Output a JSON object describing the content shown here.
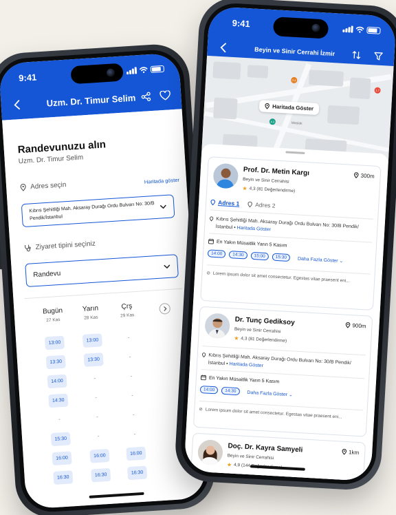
{
  "status": {
    "time": "9:41"
  },
  "colors": {
    "brand": "#1556d6",
    "chip_bg": "#e1ebfb",
    "rating_star": "#f0a020"
  },
  "left_screen": {
    "header_title": "Uzm. Dr. Timur Selim",
    "page_title": "Randevunuzu alın",
    "doctor_name": "Uzm. Dr. Timur Selim",
    "address_label": "Adres seçin",
    "map_link": "Haritada göster",
    "address_value": "Kıbrıs Şehitliği Mah. Aksaray Durağı Ordu Bulvarı No: 30/B Pendik/İstanbul",
    "visit_label": "Ziyaret tipini seçiniz",
    "visit_value": "Randevu",
    "days": [
      {
        "name": "Bugün",
        "date": "27 Kas"
      },
      {
        "name": "Yarın",
        "date": "28 Kas"
      },
      {
        "name": "Çrş",
        "date": "29 Kas"
      }
    ],
    "slots": [
      [
        "13:00",
        "13:00",
        "-"
      ],
      [
        "13:30",
        "13:30",
        "-"
      ],
      [
        "14:00",
        "-",
        "-"
      ],
      [
        "14:30",
        "-",
        "-"
      ],
      [
        "-",
        "-",
        "-"
      ],
      [
        "15:30",
        "-",
        "-"
      ],
      [
        "16:00",
        "16:00",
        "16:00"
      ],
      [
        "16:30",
        "16:30",
        "16:30"
      ]
    ]
  },
  "right_screen": {
    "header_title": "Beyin ve Sinir Cerrahi İzmir",
    "map_button": "Haritada Göster",
    "map_place": "Maslak",
    "map_pins": [
      "2.4",
      "4.3",
      "1.7"
    ],
    "doctors": [
      {
        "name": "Prof. Dr. Metin Kargı",
        "specialty": "Beyin ve Sinir Cerrahisi",
        "rating": "4,3 (81 Değerlendirme)",
        "distance": "300m",
        "tabs": [
          "Adres 1",
          "Adres 2"
        ],
        "address": "Kıbrıs Şehitliği Mah. Aksaray Durağı Ordu Bulvarı No: 30/B Pendik/İstanbul",
        "address_link": "Haritada Göster",
        "availability": "En Yakın Müsaitlik Yarın 5 Kasım",
        "times": [
          "14:00",
          "14:30",
          "15:00",
          "15:30"
        ],
        "more": "Daha Fazla Göster",
        "about": "Lorem ipsum dolor sit amet consectetur. Egestas vitae praesent eni..."
      },
      {
        "name": "Dr. Tunç Gediksoy",
        "specialty": "Beyin ve Sinir Cerrahisi",
        "rating": "4,3 (81 Değerlendirme)",
        "distance": "900m",
        "address": "Kıbrıs Şehitliği Mah. Aksaray Durağı Ordu Bulvarı No: 30/B Pendik/İstanbul",
        "address_link": "Haritada Göster",
        "availability": "En Yakın Müsaitlik Yarın 5 Kasım",
        "times": [
          "14:00",
          "14:30"
        ],
        "more": "Daha Fazla Göster",
        "about": "Lorem ipsum dolor sit amet consectetur. Egestas vitae praesent eni..."
      },
      {
        "name": "Doç. Dr. Kayra Samyeli",
        "specialty": "Beyin ve Sinir Cerrahisi",
        "rating": "4,9 (144 Değerlendirme)",
        "distance": "1km"
      }
    ]
  }
}
